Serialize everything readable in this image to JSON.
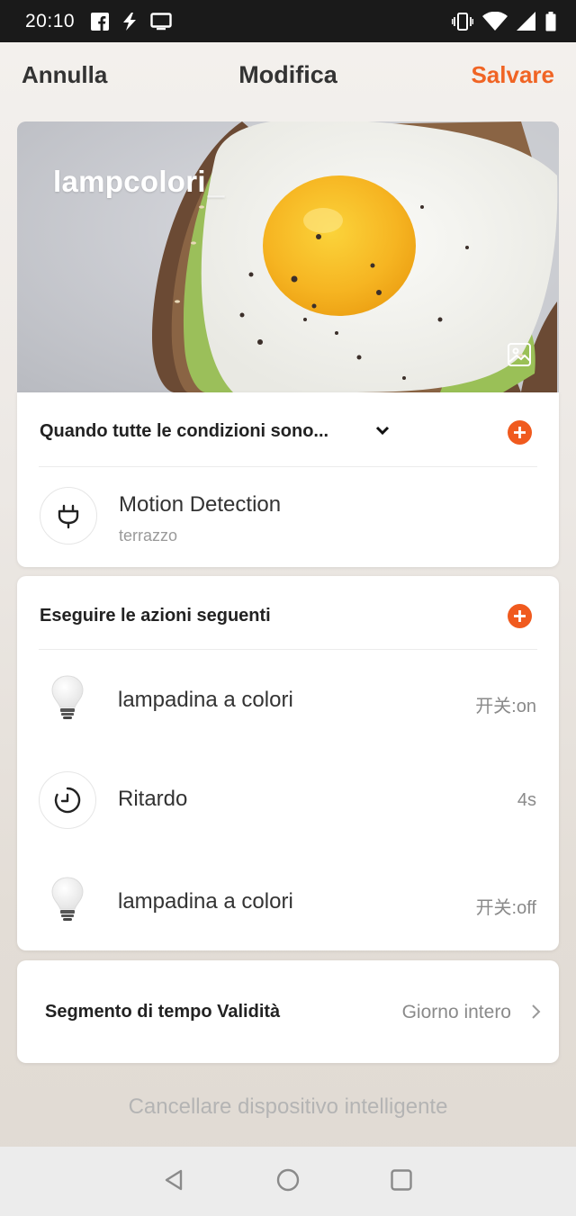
{
  "status_bar": {
    "time": "20:10",
    "left_icons": [
      "facebook-icon",
      "flash-icon",
      "screen-cast-icon"
    ],
    "right_icons": [
      "vibrate-icon",
      "wifi-icon",
      "signal-icon",
      "battery-icon"
    ]
  },
  "header": {
    "cancel_label": "Annulla",
    "title": "Modifica",
    "save_label": "Salvare",
    "accent_color": "#f06424"
  },
  "cover": {
    "scene_name": "lampcolori",
    "cursor": "_",
    "edit_image_icon": "image-icon"
  },
  "conditions": {
    "title": "Quando tutte le condizioni sono...",
    "dropdown_icon": "chevron-down-icon",
    "add_icon": "add-icon",
    "items": [
      {
        "icon": "plug-icon",
        "title": "Motion Detection",
        "subtitle": "terrazzo"
      }
    ]
  },
  "actions": {
    "title": "Eseguire le azioni seguenti",
    "add_icon": "add-icon",
    "items": [
      {
        "icon": "bulb-icon",
        "title": "lampadina a colori",
        "value": "开关:on"
      },
      {
        "icon": "timer-icon",
        "title": "Ritardo",
        "value": "4s"
      },
      {
        "icon": "bulb-icon",
        "title": "lampadina a colori",
        "value": "开关:off"
      }
    ]
  },
  "validity": {
    "label": "Segmento di tempo Validità",
    "value": "Giorno intero",
    "chevron": "chevron-right-icon"
  },
  "delete_label": "Cancellare dispositivo intelligente",
  "nav_bar": [
    "back-icon",
    "home-icon",
    "recents-icon"
  ]
}
